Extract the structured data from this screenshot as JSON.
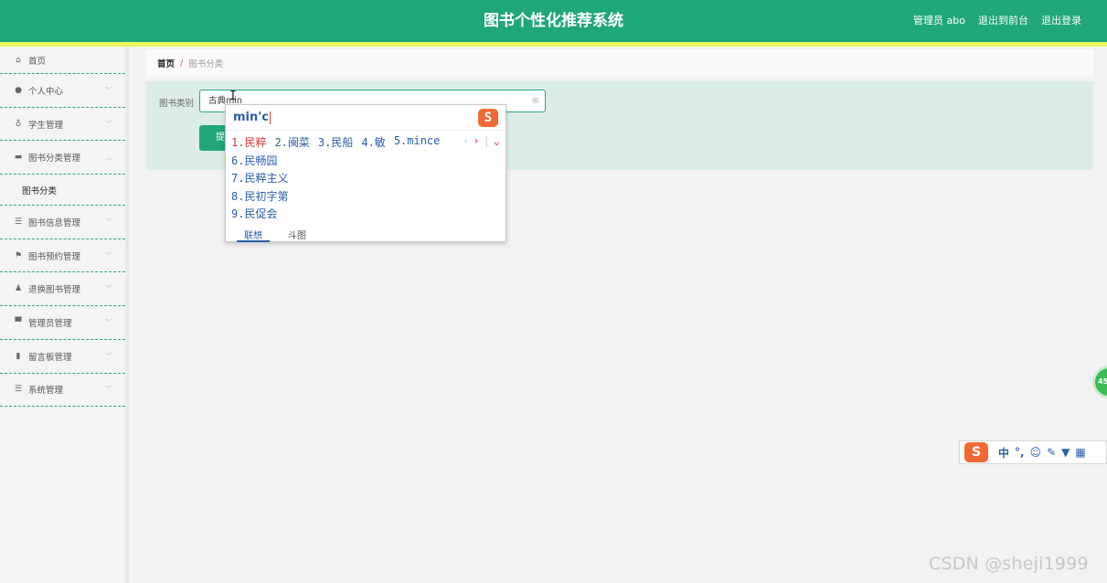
{
  "header": {
    "title": "图书个性化推荐系统",
    "admin_label": "管理员 abo",
    "back_to_front": "退出到前台",
    "logout": "退出登录"
  },
  "sidebar": {
    "items": [
      {
        "label": "首页",
        "icon": "home-icon"
      },
      {
        "label": "个人中心",
        "icon": "user-icon"
      },
      {
        "label": "学生管理",
        "icon": "mic-icon"
      },
      {
        "label": "图书分类管理",
        "icon": "book-icon",
        "expanded": true
      },
      {
        "label": "图书分类",
        "sub": true
      },
      {
        "label": "图书信息管理",
        "icon": "list-icon"
      },
      {
        "label": "图书预约管理",
        "icon": "flag-icon"
      },
      {
        "label": "退换图书管理",
        "icon": "person-icon"
      },
      {
        "label": "管理员管理",
        "icon": "monitor-icon"
      },
      {
        "label": "留言板管理",
        "icon": "bar-chart-icon"
      },
      {
        "label": "系统管理",
        "icon": "menu-icon"
      }
    ]
  },
  "breadcrumb": {
    "home": "首页",
    "separator": "/",
    "current": "图书分类"
  },
  "form": {
    "label": "图书类别",
    "input_value": "古典min",
    "submit_label": "提"
  },
  "ime": {
    "composition": "min'c",
    "logo": "S",
    "candidates_row": [
      "1.民粹",
      "2.闽菜",
      "3.民船",
      "4.敏",
      "5.mince"
    ],
    "candidates_list": [
      "6.民畅园",
      "7.民粹主义",
      "8.民初字第",
      "9.民促会"
    ],
    "tabs": [
      "联想",
      "斗图"
    ]
  },
  "float_ball": {
    "text": "45"
  },
  "ime_toolbar": {
    "logo": "S",
    "mode": "中",
    "punct": "°,",
    "emoji": "☺",
    "pen": "✎",
    "mic": "🎤",
    "grid": "▦"
  },
  "watermark": "CSDN @sheji1999",
  "colors": {
    "primary": "#1fa67a",
    "accent_line": "#e8f55a",
    "ime_blue": "#2b5ea8",
    "ime_red": "#d43b3b"
  }
}
